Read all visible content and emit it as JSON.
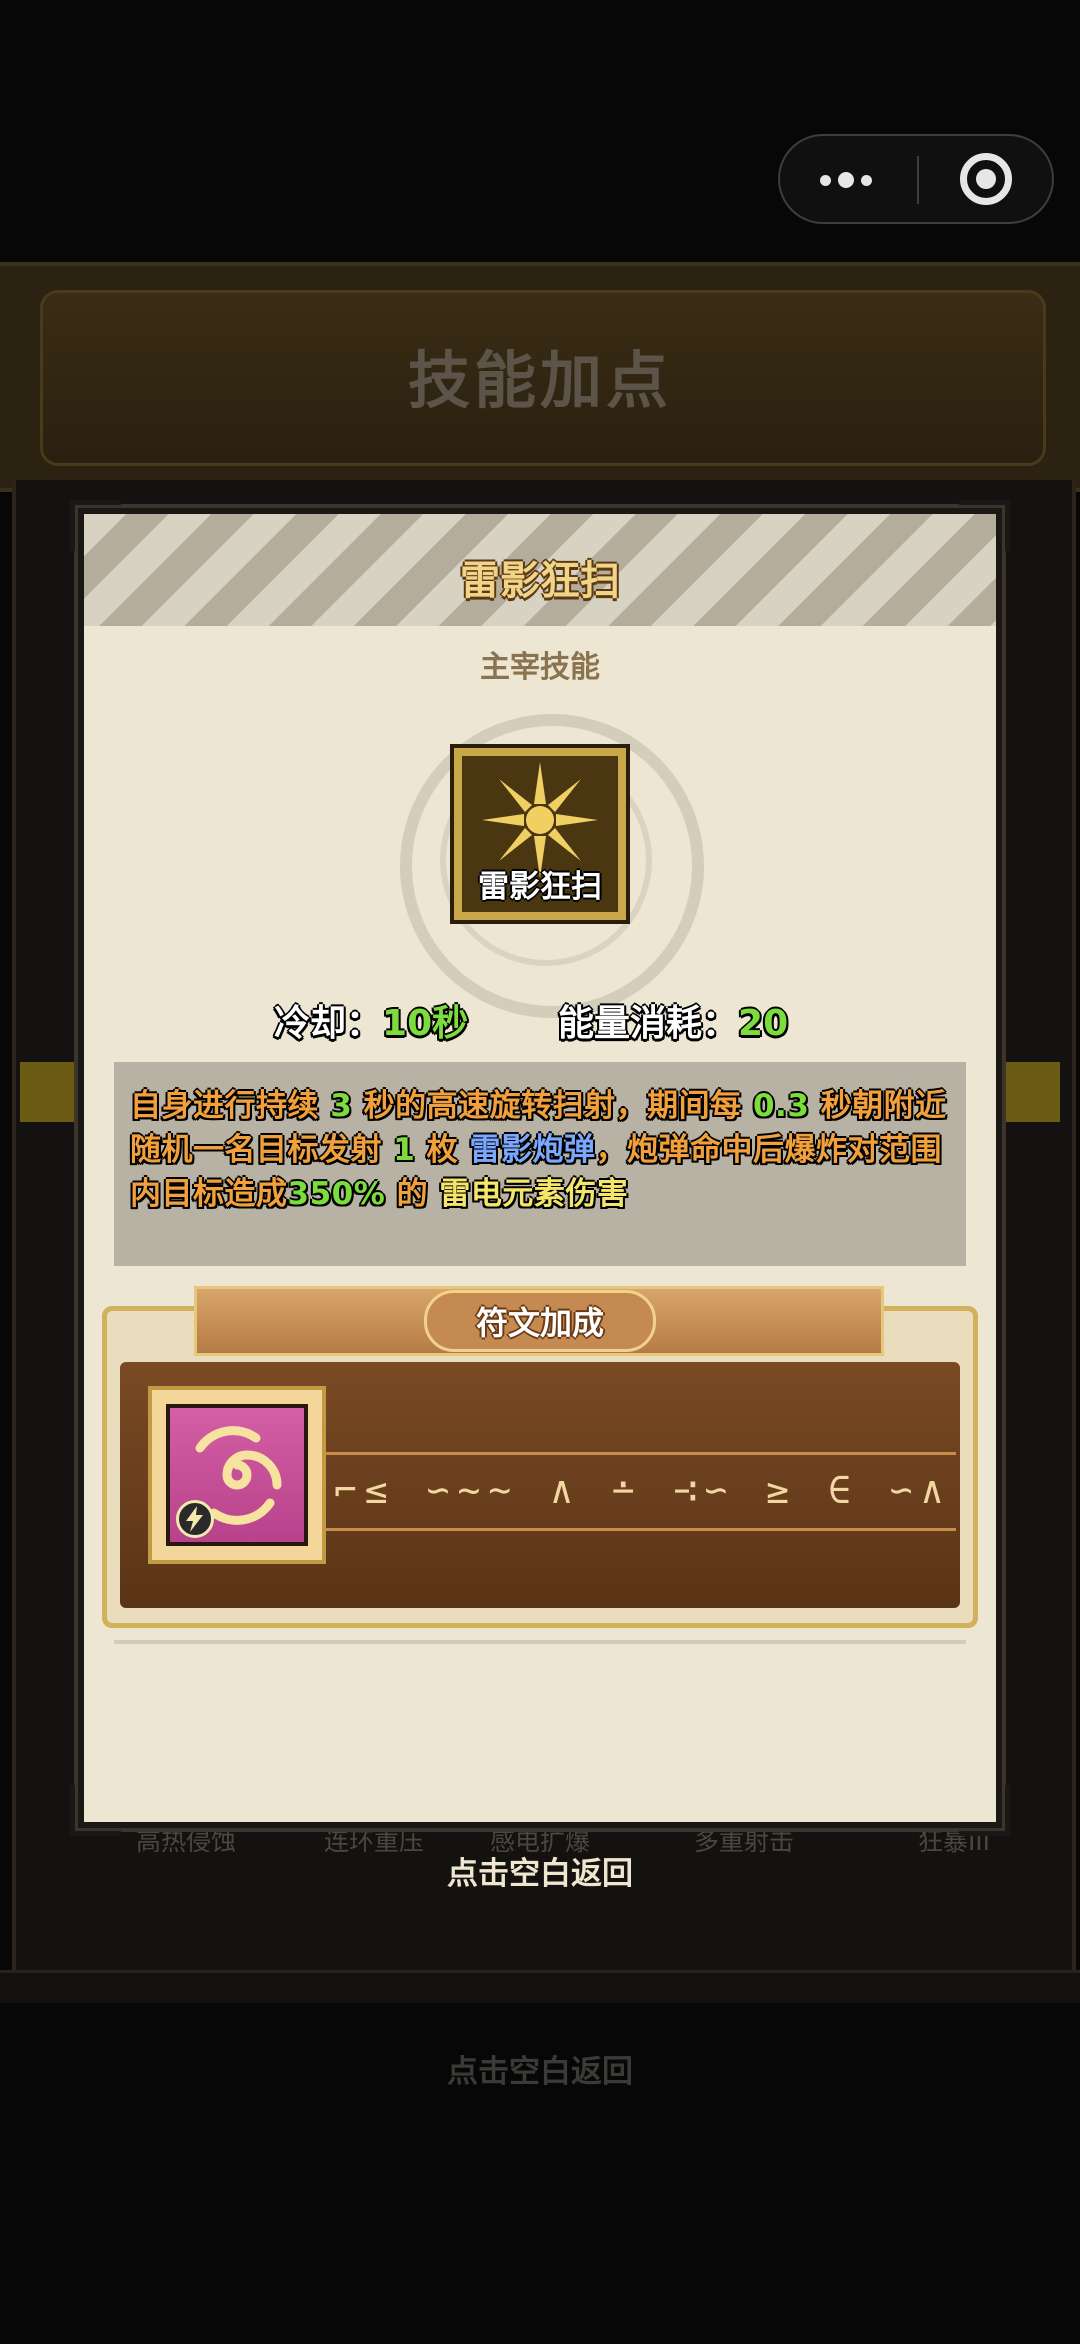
{
  "background": {
    "screen_title": "技能加点",
    "skill_labels": [
      "高热侵蚀",
      "连环重压",
      "感电扩爆",
      "多重射击",
      "狂暴III"
    ],
    "return_hint": "点击空白返回"
  },
  "modal": {
    "title": "雷影狂扫",
    "skill_type": "主宰技能",
    "icon_label": "雷影狂扫",
    "cooldown_label": "冷却：",
    "cooldown_value": "10秒",
    "energy_label": "能量消耗：",
    "energy_value": "20",
    "description": {
      "p1": "自身进行持续",
      "n1": "3",
      "p2": "秒的高速旋转扫射，期间每",
      "n2": "0.3",
      "p3": "秒朝附近随机一名目标发射",
      "n3": "1",
      "p4": "枚",
      "projectile": "雷影炮弹",
      "p5": "，炮弹命中后爆炸对范围内目标造成",
      "n4": "350%",
      "p6": "的",
      "element": "雷电元素伤害"
    },
    "rune_section_title": "符文加成",
    "rune_glyphs": "⌐≤ ∽~∼ ∧ ∸ ∹∽ ≥ ∈ ∽∧"
  },
  "return_hint": "点击空白返回",
  "colors": {
    "accent_green": "#7cdc3c",
    "accent_blue": "#7aa8ff",
    "accent_yellow": "#f5e66a",
    "desc_orange": "#f2a03c",
    "title_gold": "#f1d38a"
  },
  "icons": {
    "skill_icon": "sun-burst-icon",
    "rune_icon": "spiral-icon",
    "rune_badge": "lightning-bolt-icon"
  }
}
